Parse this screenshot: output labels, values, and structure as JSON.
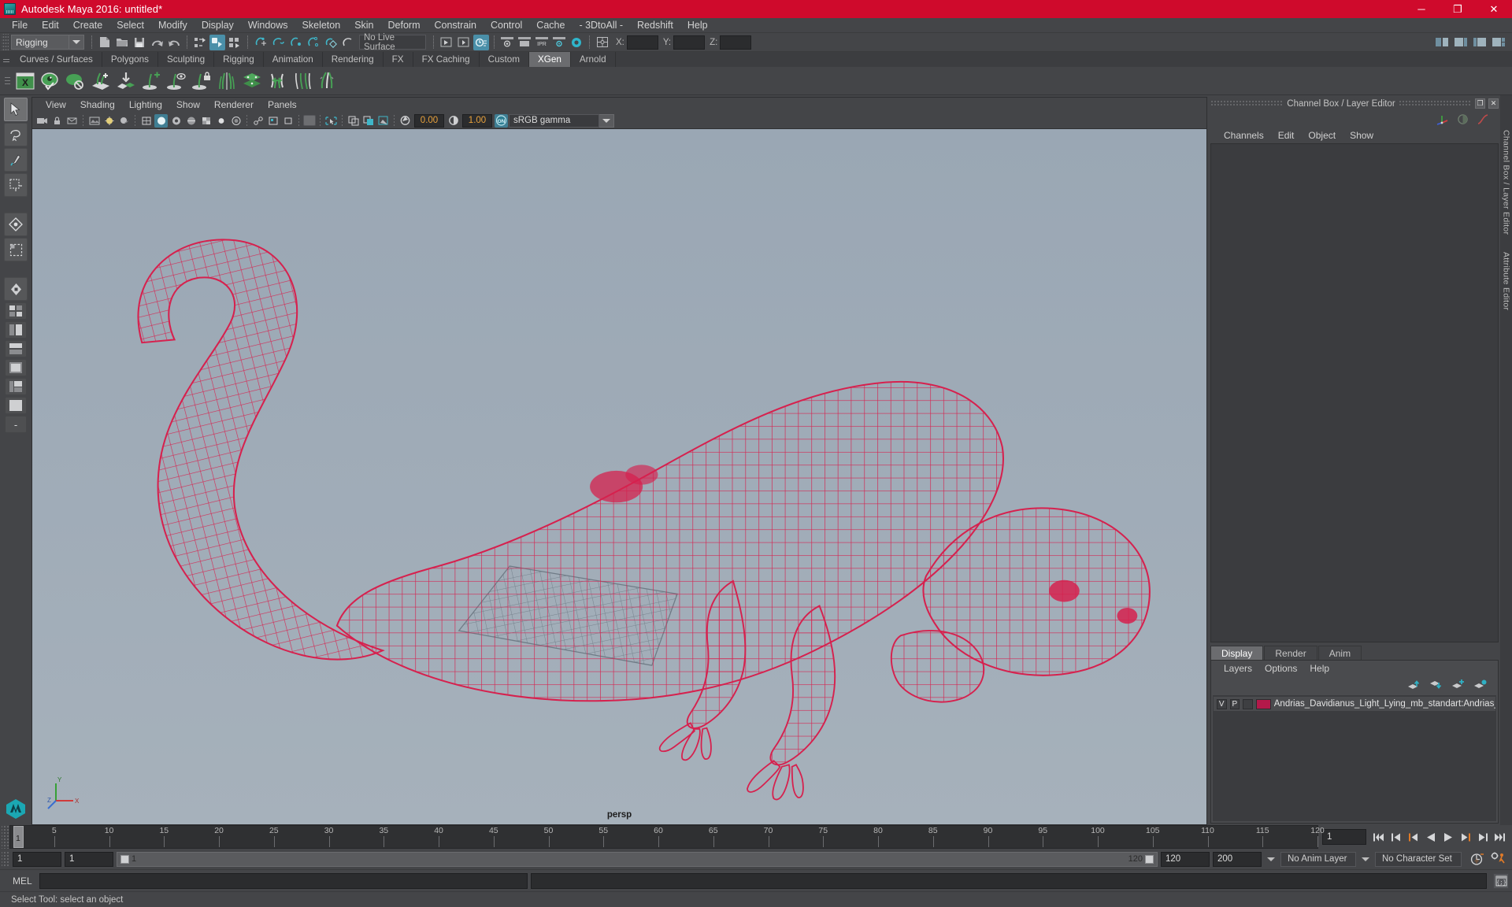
{
  "window": {
    "title": "Autodesk Maya 2016: untitled*",
    "app_icon": "maya-logo-icon",
    "controls": {
      "minimize": "─",
      "maximize": "❐",
      "close": "✕"
    },
    "title_bar_color": "#cf0a2c"
  },
  "menu_bar": {
    "items": [
      "File",
      "Edit",
      "Create",
      "Select",
      "Modify",
      "Display",
      "Windows",
      "Skeleton",
      "Skin",
      "Deform",
      "Constrain",
      "Control",
      "Cache",
      "- 3DtoAll -",
      "Redshift",
      "Help"
    ]
  },
  "status_line": {
    "menu_set": "Rigging",
    "live_surface": "No Live Surface",
    "coord_labels": {
      "x": "X:",
      "y": "Y:",
      "z": "Z:"
    },
    "coord_values": {
      "x": "",
      "y": "",
      "z": ""
    }
  },
  "shelf": {
    "tabs": [
      "Curves / Surfaces",
      "Polygons",
      "Sculpting",
      "Rigging",
      "Animation",
      "Rendering",
      "FX",
      "FX Caching",
      "Custom",
      "XGen",
      "Arnold"
    ],
    "active_tab": "XGen",
    "icons": [
      "xgen-editor-icon",
      "preview-visible-icon",
      "preview-hidden-icon",
      "create-description-icon",
      "import-collection-icon",
      "add-guide-icon",
      "guide-visibility-icon",
      "lock-guide-icon",
      "mirror-guides-icon",
      "layers-icon",
      "grooming-tool-icon",
      "comb-tool-icon",
      "clump-tool-icon"
    ]
  },
  "toolbox": {
    "tools": [
      "select-tool",
      "lasso-select-tool",
      "paint-select-tool",
      "move-tool",
      "rotate-tool",
      "scale-tool",
      "last-tool"
    ],
    "layouts": [
      "single-perspective-layout",
      "four-view-layout",
      "outliner-persp-layout",
      "persp-graph-layout",
      "hypershade-persp-layout",
      "outliner-persp-graph-layout",
      "persp-layout"
    ],
    "active_tool": "select-tool"
  },
  "viewport": {
    "menus": [
      "View",
      "Shading",
      "Lighting",
      "Show",
      "Renderer",
      "Panels"
    ],
    "camera_label": "persp",
    "toolbar": {
      "exposure_value": "0.00",
      "gamma_value": "1.00",
      "color_management_toggle": "ON",
      "color_profile": "sRGB gamma"
    },
    "background_top": "#9aa7b4",
    "background_bottom": "#a6b1bb",
    "model": {
      "name": "Andrias Davidianus wireframe",
      "wireframe_color": "#d6214e",
      "plane_color": "#7e8a96"
    },
    "axis_gizmo": {
      "x": "X",
      "y": "Y",
      "z": "Z"
    }
  },
  "channel_box": {
    "panel_title": "Channel Box / Layer Editor",
    "menus": [
      "Channels",
      "Edit",
      "Object",
      "Show"
    ],
    "window_buttons": {
      "undock": "❐",
      "close": "✕"
    },
    "header_icons": [
      "transform-axis-icon",
      "half-circle-icon",
      "anim-curve-icon"
    ]
  },
  "layer_editor": {
    "tabs": [
      "Display",
      "Render",
      "Anim"
    ],
    "active_tab": "Display",
    "menus": [
      "Layers",
      "Options",
      "Help"
    ],
    "toolbar_icons": [
      "move-layer-up-icon",
      "move-layer-down-icon",
      "new-layer-icon",
      "new-layer-from-selected-icon"
    ],
    "layers": [
      {
        "visibility": "V",
        "playback": "P",
        "state": "",
        "color": "#b3194a",
        "name": "Andrias_Davidianus_Light_Lying_mb_standart:Andrias_D"
      }
    ]
  },
  "right_dock_tabs": [
    "Channel Box / Layer Editor",
    "Attribute Editor"
  ],
  "timeline": {
    "ticks": [
      {
        "label": "5",
        "frame": 5
      },
      {
        "label": "10",
        "frame": 10
      },
      {
        "label": "15",
        "frame": 15
      },
      {
        "label": "20",
        "frame": 20
      },
      {
        "label": "25",
        "frame": 25
      },
      {
        "label": "30",
        "frame": 30
      },
      {
        "label": "35",
        "frame": 35
      },
      {
        "label": "40",
        "frame": 40
      },
      {
        "label": "45",
        "frame": 45
      },
      {
        "label": "50",
        "frame": 50
      },
      {
        "label": "55",
        "frame": 55
      },
      {
        "label": "60",
        "frame": 60
      },
      {
        "label": "65",
        "frame": 65
      },
      {
        "label": "70",
        "frame": 70
      },
      {
        "label": "75",
        "frame": 75
      },
      {
        "label": "80",
        "frame": 80
      },
      {
        "label": "85",
        "frame": 85
      },
      {
        "label": "90",
        "frame": 90
      },
      {
        "label": "95",
        "frame": 95
      },
      {
        "label": "100",
        "frame": 100
      },
      {
        "label": "105",
        "frame": 105
      },
      {
        "label": "110",
        "frame": 110
      },
      {
        "label": "115",
        "frame": 115
      },
      {
        "label": "120",
        "frame": 120
      }
    ],
    "current_frame_marker": "1",
    "current_frame_field": "1",
    "playback_buttons": [
      "go-to-start-icon",
      "step-back-keyframe-icon",
      "step-back-frame-icon",
      "play-backwards-icon",
      "play-forwards-icon",
      "step-forward-frame-icon",
      "step-forward-keyframe-icon",
      "go-to-end-icon"
    ]
  },
  "range_slider": {
    "anim_start": "1",
    "range_start": "1",
    "bar_start_label": "1",
    "bar_end_label": "120",
    "range_end": "120",
    "anim_end": "200",
    "anim_layer": "No Anim Layer",
    "character_set": "No Character Set",
    "auto_key_icon": "auto-keyframe-icon",
    "anim_prefs_icon": "animation-preferences-icon"
  },
  "command_line": {
    "label": "MEL",
    "input_value": "",
    "output_value": "",
    "script_editor_icon": "script-editor-icon"
  },
  "help_line": {
    "text": "Select Tool: select an object"
  }
}
